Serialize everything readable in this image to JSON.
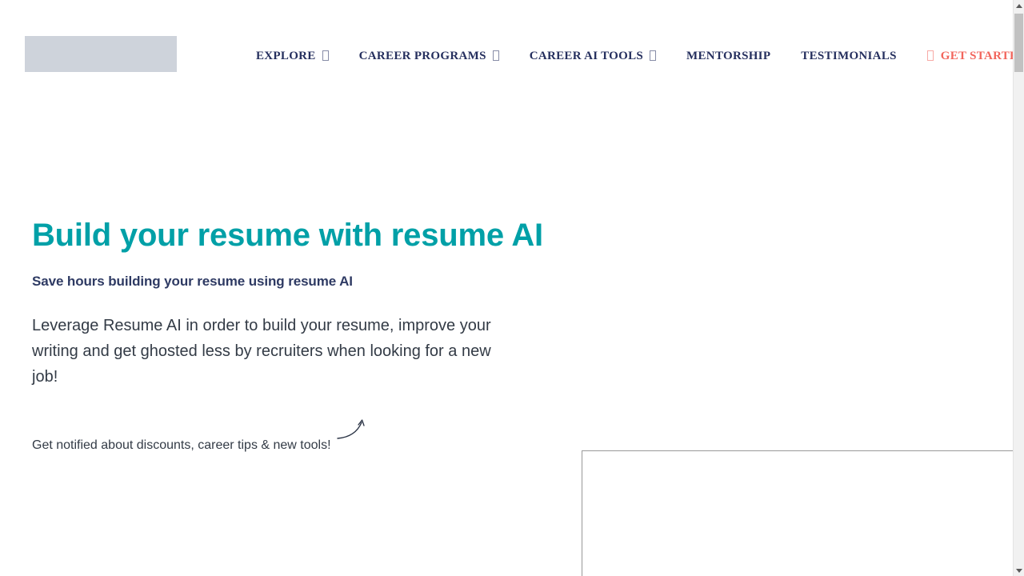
{
  "header": {
    "logo": {
      "alt": "site-logo",
      "state": "broken-image-placeholder"
    },
    "nav_items": [
      {
        "label": "EXPLORE",
        "has_dropdown": true,
        "cta": false
      },
      {
        "label": "CAREER PROGRAMS",
        "has_dropdown": true,
        "cta": false
      },
      {
        "label": "CAREER AI TOOLS",
        "has_dropdown": true,
        "cta": false
      },
      {
        "label": "MENTORSHIP",
        "has_dropdown": false,
        "cta": false
      },
      {
        "label": "TESTIMONIALS",
        "has_dropdown": false,
        "cta": false
      },
      {
        "label": "GET STARTED",
        "has_dropdown": false,
        "cta": true
      }
    ]
  },
  "hero": {
    "title": "Build your resume with resume AI",
    "subtitle": "Save hours building your resume using resume AI",
    "paragraph": "Leverage Resume AI in order to build your resume, improve your writing and get ghosted less by recruiters when looking for a new job!",
    "notify_text": "Get notified about discounts, career tips & new tools!",
    "arrow_icon": "curved-arrow-up-right-icon"
  },
  "embed": {
    "label": "embedded-signup-frame",
    "content": ""
  },
  "scrollbar": {
    "up_icon": "triangle-up-icon",
    "down_icon": "triangle-down-icon",
    "thumb": "scroll-thumb"
  },
  "colors": {
    "teal": "#00a0a7",
    "navy": "#252f5e",
    "subtitle_navy": "#2e3a63",
    "coral": "#f2655c",
    "body_text": "#333b46",
    "logo_placeholder": "#ced3db",
    "embed_border": "#999999",
    "background": "#ffffff"
  }
}
